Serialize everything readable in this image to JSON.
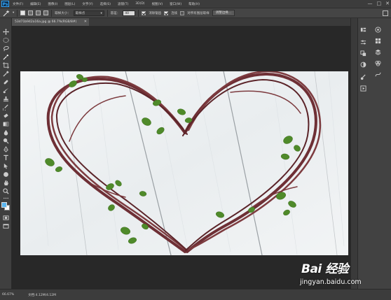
{
  "app": {
    "logo": "Ps",
    "menu": [
      "文件(F)",
      "编辑(E)",
      "图像(I)",
      "图层(L)",
      "文字(Y)",
      "选择(S)",
      "滤镜(T)",
      "3D(D)",
      "视图(V)",
      "窗口(W)",
      "帮助(H)"
    ],
    "window_controls": [
      "—",
      "□",
      "✕"
    ]
  },
  "options": {
    "brush_size_label": "取样大小：",
    "brush_size_value": "取样点",
    "tolerance_label": "容差：",
    "tolerance_value": "40",
    "antialias_label": "消除锯齿",
    "antialias_checked": true,
    "contiguous_label": "连续",
    "contiguous_checked": true,
    "all_layers_label": "对所有图层取样",
    "all_layers_checked": false,
    "refine_button": "调整边缘..."
  },
  "document": {
    "tab_title": "53d71b942a16a.jpg @ 66.7%(RGB/8#)",
    "close": "✕"
  },
  "status": {
    "zoom": "66.67%",
    "doc_info": "文档:4.12M/4.12M"
  },
  "watermark": {
    "brand": "Bai 经验",
    "url": "jingyan.baidu.com"
  },
  "colors": {
    "foreground": "#5bb6f0",
    "background": "#ffffff",
    "accent": "#31a8ff"
  }
}
